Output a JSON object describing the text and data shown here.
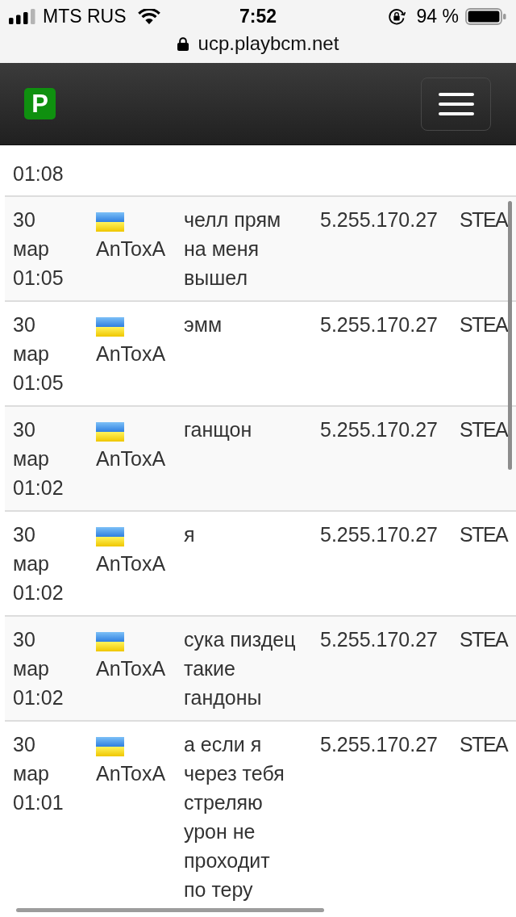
{
  "status_bar": {
    "carrier": "MTS RUS",
    "time": "7:52",
    "battery": "94 %"
  },
  "address_bar": {
    "url": "ucp.playbcm.net"
  },
  "navbar": {
    "logo": "P"
  },
  "table": {
    "rows": [
      {
        "kind": "cut",
        "date": "01:08"
      },
      {
        "kind": "full",
        "date": "30 мар 01:05",
        "name": "AnToxA",
        "message": "челл прям на меня вышел",
        "ip": "5.255.170.27",
        "column_5": "STEA"
      },
      {
        "kind": "full",
        "date": "30 мар 01:05",
        "name": "AnToxA",
        "message": "эмм",
        "ip": "5.255.170.27",
        "column_5": "STEA"
      },
      {
        "kind": "full",
        "date": "30 мар 01:02",
        "name": "AnToxA",
        "message": "ганщон",
        "ip": "5.255.170.27",
        "column_5": "STEA"
      },
      {
        "kind": "full",
        "date": "30 мар 01:02",
        "name": "AnToxA",
        "message": "я",
        "ip": "5.255.170.27",
        "column_5": "STEA"
      },
      {
        "kind": "full",
        "date": "30 мар 01:02",
        "name": "AnToxA",
        "message": "сука пиздец такие гандоны",
        "ip": "5.255.170.27",
        "column_5": "STEA"
      },
      {
        "kind": "full",
        "date": "30 мар 01:01",
        "name": "AnToxA",
        "message": "а если я через тебя стреляю урон не проходит по теру",
        "ip": "5.255.170.27",
        "column_5": "STEA"
      }
    ]
  }
}
